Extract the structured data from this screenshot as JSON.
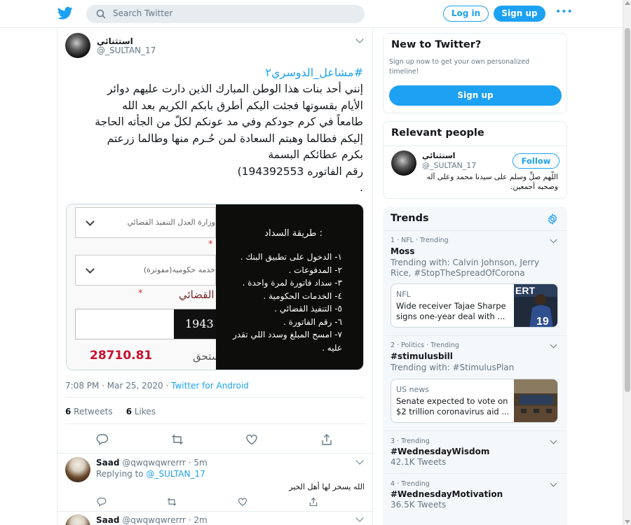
{
  "header": {
    "search_placeholder": "Search Twitter",
    "login_label": "Log in",
    "signup_label": "Sign up",
    "more_label": "•••"
  },
  "tweet": {
    "author_name": "استثنائي",
    "author_handle": "@_SULTAN_17",
    "hashtag": "#مشاعل_الدوسري٢",
    "text_lines": [
      "إنني أحد بنات هذا الوطن المبارك الذين دارت عليهم دوائر",
      "الأيام بقسوتها فجئت اليكم أطرق بابكم الكريم بعد الله",
      "طامعاً في كرم جودكم وفي مد عونكم لكلّ من الجأته الحاجة",
      "إليكم فطالما وهبتم السعادة لمن حُـرم منها وطالما زرعتم",
      "بكرم عطائكم البسمة",
      "رقم الفاتوره 194392553)",
      "."
    ],
    "media": {
      "dropdown1_text": "وزارة العدل التنفيذ القضائي",
      "dropdown2_text": "خدمه حكوميه(مفوترة)",
      "section_label": "التنفيذ القضائي",
      "code_partial": "1943",
      "amount": "28710.81",
      "dues_label": "ستحق",
      "payment_title": ": طريقة السداد",
      "payment_steps": [
        "١- الدخول على تطبيق البنك .",
        "٢- المدفوعات .",
        "٣- سداد فاتورة لمرة واحدة .",
        "٤- الخدمات الحكومية .",
        "٥- التنفيذ القضائي .",
        "٦- رقم الفاتورة .",
        "٧- امسح المبلغ وسدد اللي تقدر",
        "عليه ."
      ]
    },
    "timestamp": "7:08 PM · Mar 25, 2020 · ",
    "source": "Twitter for Android",
    "retweets_count": "6",
    "retweets_label": " Retweets",
    "likes_count": "6",
    "likes_label": " Likes"
  },
  "replies": [
    {
      "name": "Saad",
      "handle_time": " @qwqwqwrerrr · 5m",
      "replying_to_label": "Replying to ",
      "replying_to_handle": "@_SULTAN_17",
      "text": "الله يسخر لها أهل الخير"
    },
    {
      "name": "Saad",
      "handle_time": " @qwqwqwrerrr · 2m"
    }
  ],
  "sidebar": {
    "new_title": "New to Twitter?",
    "new_sub": "Sign up now to get your own personalized timeline!",
    "signup_label": "Sign up",
    "relevant_title": "Relevant people",
    "person_name": "استثنائي",
    "person_handle": "@_SULTAN_17",
    "follow_label": "Follow",
    "person_bio": "اللّهم صلِّ وسلم على سيدنا محمد وعلى آله وصحبه أجمعين.",
    "trends_title": "Trends",
    "trends": [
      {
        "meta": "1 · NFL · Trending",
        "name": "Moss",
        "sub": "Trending with: Calvin Johnson, Jerry Rice, #StopTheSpreadOfCorona",
        "news_cat": "NFL",
        "news_head": "Wide receiver Tajae Sharpe signs one-year deal with ..."
      },
      {
        "meta": "2 · Politics · Trending",
        "name": "#stimulusbill",
        "sub": "Trending with: #StimulusPlan",
        "news_cat": "US news",
        "news_head": "Senate expected to vote on $2 trillion coronavirus aid ..."
      },
      {
        "meta": "3 · Trending",
        "name": "#WednesdayWisdom",
        "sub": "42.1K Tweets"
      },
      {
        "meta": "4 · Trending",
        "name": "#WednesdayMotivation",
        "sub": "36.5K Tweets"
      }
    ]
  },
  "colors": {
    "brand": "#1da1f2",
    "text": "#14171a",
    "muted": "#657786",
    "amount_red": "#c8102e"
  }
}
